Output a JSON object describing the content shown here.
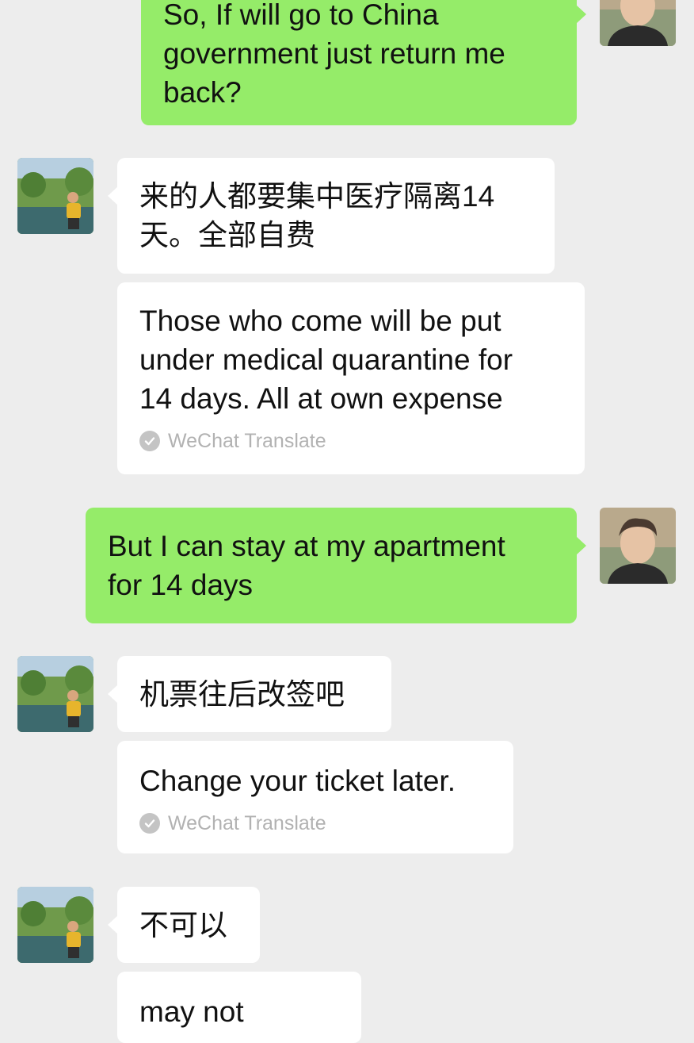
{
  "messages": [
    {
      "id": "m1",
      "direction": "outgoing",
      "text": "So, If will go to China\ngovernment just return me\nback?",
      "avatar": "avatar-young-man-icon"
    },
    {
      "id": "m2",
      "direction": "incoming",
      "text": "来的人都要集中医疗隔离14\n天。全部自费",
      "translation": "Those who come will be put\nunder medical quarantine for\n14 days. All at own expense",
      "translation_label": "WeChat Translate",
      "avatar": "avatar-woman-by-pond-icon"
    },
    {
      "id": "m3",
      "direction": "outgoing",
      "text": "But I can stay at my apartment\nfor 14 days",
      "avatar": "avatar-young-man-icon"
    },
    {
      "id": "m4",
      "direction": "incoming",
      "text": "机票往后改签吧",
      "translation": "Change your ticket later.",
      "translation_label": "WeChat Translate",
      "avatar": "avatar-woman-by-pond-icon"
    },
    {
      "id": "m5",
      "direction": "incoming",
      "text": "不可以",
      "translation": "may not",
      "avatar": "avatar-woman-by-pond-icon"
    }
  ],
  "colors": {
    "background": "#ededed",
    "outgoing_bubble": "#95ec69",
    "incoming_bubble": "#ffffff",
    "translate_label": "#b2b2b2"
  }
}
